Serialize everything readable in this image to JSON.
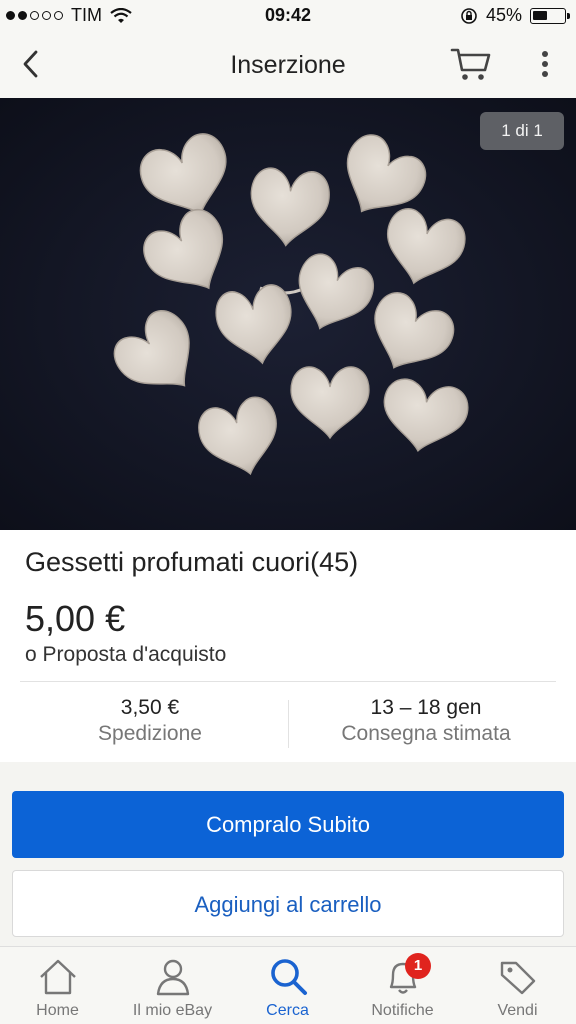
{
  "status_bar": {
    "carrier": "TIM",
    "time": "09:42",
    "battery": "45%",
    "battery_level": 0.45,
    "signal_bars_filled": 2,
    "signal_bars_total": 5
  },
  "nav": {
    "title": "Inserzione",
    "icons": [
      "back-chevron-icon",
      "cart-icon",
      "more-vertical-icon"
    ]
  },
  "gallery": {
    "counter": "1 di 1"
  },
  "listing": {
    "title": "Gessetti profumati cuori(45)",
    "price": "5,00 €",
    "offer": "o Proposta d'acquisto",
    "shipping_value": "3,50 €",
    "shipping_label": "Spedizione",
    "delivery_value": "13 – 18 gen",
    "delivery_label": "Consegna stimata"
  },
  "actions": {
    "buy_now": "Compralo Subito",
    "add_to_cart": "Aggiungi al carrello"
  },
  "tabbar": {
    "items": [
      {
        "label": "Home",
        "icon": "home-icon"
      },
      {
        "label": "Il mio eBay",
        "icon": "user-icon"
      },
      {
        "label": "Cerca",
        "icon": "search-icon",
        "active": true
      },
      {
        "label": "Notifiche",
        "icon": "bell-icon",
        "badge": "1"
      },
      {
        "label": "Vendi",
        "icon": "tag-icon"
      }
    ]
  },
  "colors": {
    "accent": "#0c63d6",
    "badge": "#e0241e",
    "photo_background": "#161928",
    "heart_color": "#d8d1c9"
  }
}
